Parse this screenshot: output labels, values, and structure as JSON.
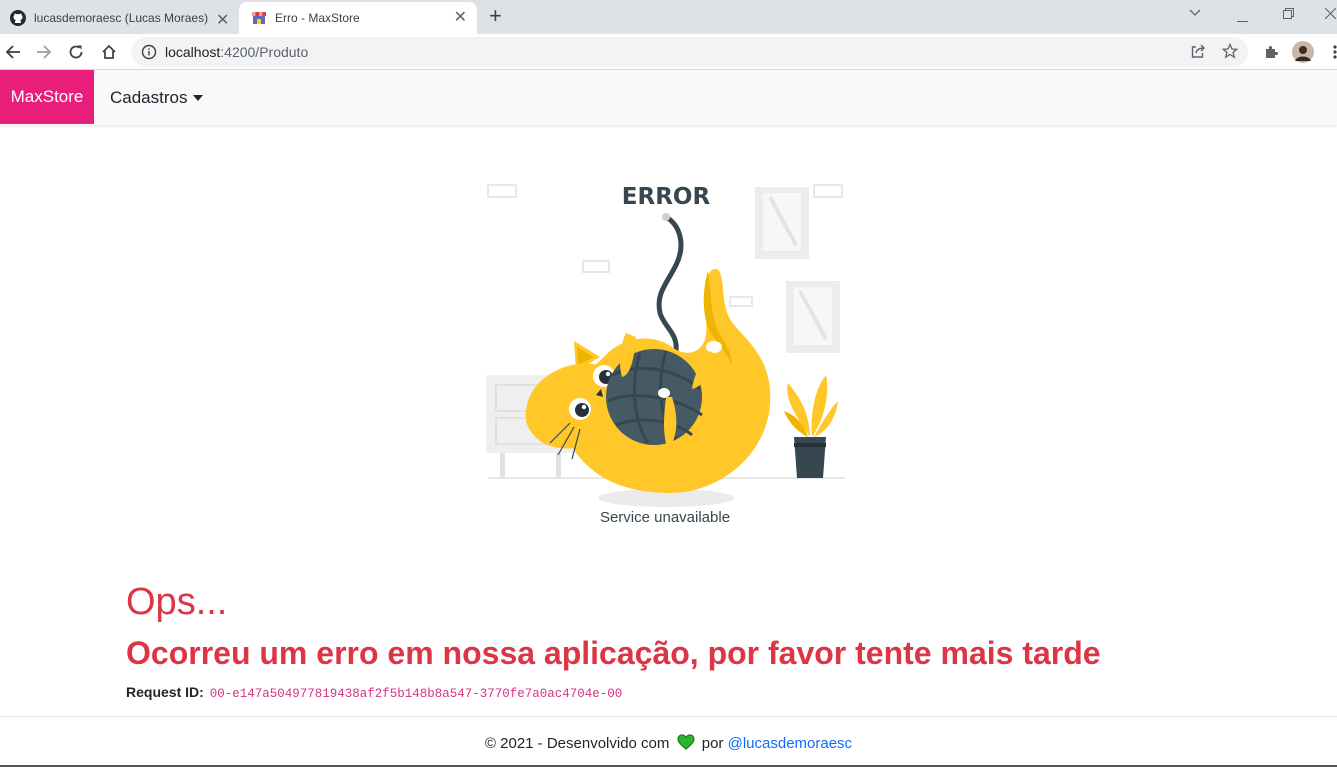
{
  "browser": {
    "tabs": [
      {
        "title": "lucasdemoraesc (Lucas Moraes) · GitHub",
        "icon": "github-icon",
        "active": false
      },
      {
        "title": "Erro - MaxStore",
        "icon": "store-icon",
        "active": true
      }
    ],
    "url_host": "localhost",
    "url_port_path": ":4200/Produto"
  },
  "navbar": {
    "brand": "MaxStore",
    "brand_color": "#e91e7a",
    "menu_label": "Cadastros"
  },
  "illustration": {
    "heading": "ERROR",
    "caption": "Service unavailable",
    "accent_color": "#ffc727"
  },
  "error": {
    "title": "Ops...",
    "message": "Ocorreu um erro em nossa aplicação, por favor tente mais tarde",
    "request_label": "Request ID:",
    "request_id": "00-e147a504977819438af2f5b148b8a547-3770fe7a0ac4704e-00",
    "color": "#dc3545"
  },
  "footer": {
    "prefix": "© 2021 - Desenvolvido com",
    "connector": "por",
    "author": "@lucasdemoraesc",
    "heart_icon": "green-heart-icon"
  }
}
